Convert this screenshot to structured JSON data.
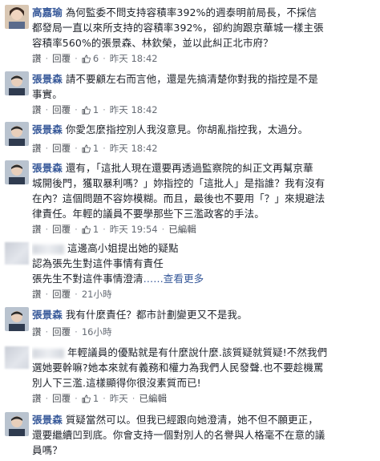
{
  "comments": [
    {
      "author": "高嘉瑜",
      "lines": [
        "為何監委不問支持容積率392%的週泰明前局長，不採信",
        "都發局一直以來所支持的容積率392%，卻約詢跟京華城一樣主張",
        "容積率560%的張景森、林欽榮，並以此糾正北市府？"
      ],
      "actions": {
        "like": "讚",
        "reply": "回覆",
        "likes": "6",
        "time": "昨天 18:42"
      }
    },
    {
      "author": "張景森",
      "lines": [
        "請不要顧左右而言他，還是先搞清楚你對我的指控是不是",
        "事實。"
      ],
      "actions": {
        "like": "讚",
        "reply": "回覆",
        "likes": "1",
        "time": "昨天 18:42"
      }
    },
    {
      "author": "張景森",
      "lines": [
        "你愛怎麼指控別人我沒意見。你胡亂指控我，太過分。"
      ],
      "actions": {
        "like": "讚",
        "reply": "回覆",
        "likes": "1",
        "time": "昨天 18:42"
      }
    },
    {
      "author": "張景森",
      "lines": [
        "還有，「這批人現在還要再透過監察院的糾正文再幫京華",
        "城開後門，獲取暴利嗎？」妳指控的「這批人」是指誰？我有沒有",
        "在內？這個問題不容妳模糊。而且，最後也不要用「？」來規避法",
        "律責任。年輕的議員不要學那些下三濫政客的手法。"
      ],
      "actions": {
        "like": "讚",
        "reply": "回覆",
        "likes": "1",
        "time": "昨天 19:54",
        "edited": "已編輯"
      }
    },
    {
      "author": "",
      "lines": [
        "這邊高小姐提出她的疑點",
        "認為張先生對這件事情有責任",
        "張先生不對這件事情澄清"
      ],
      "see_more": "……查看更多",
      "actions": {
        "like": "讚",
        "reply": "回覆",
        "time": "21小時"
      }
    },
    {
      "author": "張景森",
      "lines": [
        "我有什麼責任？都市計劃變更又不是我。"
      ],
      "actions": {
        "like": "讚",
        "reply": "回覆",
        "time": "16小時"
      }
    },
    {
      "author": "",
      "lines": [
        "年輕議員的優點就是有什麼說什麼.該質疑就質疑!不然我們",
        "選她要幹嘛?她本來就有義務和權力為我們人民發聲.也不要趁機罵",
        "別人下三濫.這樣顯得你很沒素質而已!"
      ],
      "actions": {
        "like": "讚",
        "reply": "回覆",
        "likes": "1",
        "time": "昨天",
        "edited": "已編輯"
      }
    },
    {
      "author": "張景森",
      "lines": [
        "質疑當然可以。但我已經跟向她澄清，她不但不願更正，",
        "還要繼續凹到底。你會支持一個對別人的名譽與人格毫不在意的議",
        "員嗎？"
      ]
    }
  ],
  "colors": {
    "name": "#365899",
    "text": "#1d2129",
    "meta": "#90949c"
  }
}
